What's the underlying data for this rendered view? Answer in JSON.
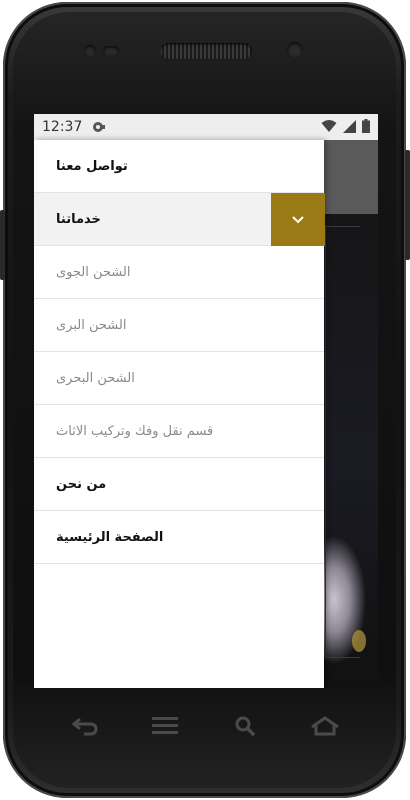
{
  "status": {
    "time": "12:37",
    "icons": [
      "notification-icon",
      "wifi-icon",
      "signal-icon",
      "battery-icon"
    ]
  },
  "drawer": {
    "items": [
      {
        "label": "تواصل معنا",
        "style": "bold"
      },
      {
        "label": "خدماتنا",
        "style": "bold",
        "expanded": true
      },
      {
        "label": "الشحن الجوى",
        "style": "sub"
      },
      {
        "label": "الشحن البرى",
        "style": "sub"
      },
      {
        "label": "الشحن البحرى",
        "style": "sub"
      },
      {
        "label": "قسم نقل وفك وتركيب الاثاث",
        "style": "sub"
      },
      {
        "label": "من نحن",
        "style": "bold"
      },
      {
        "label": "الصفحة الرئيسية",
        "style": "bold"
      }
    ]
  },
  "colors": {
    "accent": "#9a7a14",
    "drawer_bg": "#ffffff",
    "divider": "#e4e4e4",
    "sub_text": "#8a8a8a"
  },
  "navbar": {
    "icons": [
      "back-icon",
      "menu-icon",
      "search-icon",
      "home-icon"
    ]
  }
}
